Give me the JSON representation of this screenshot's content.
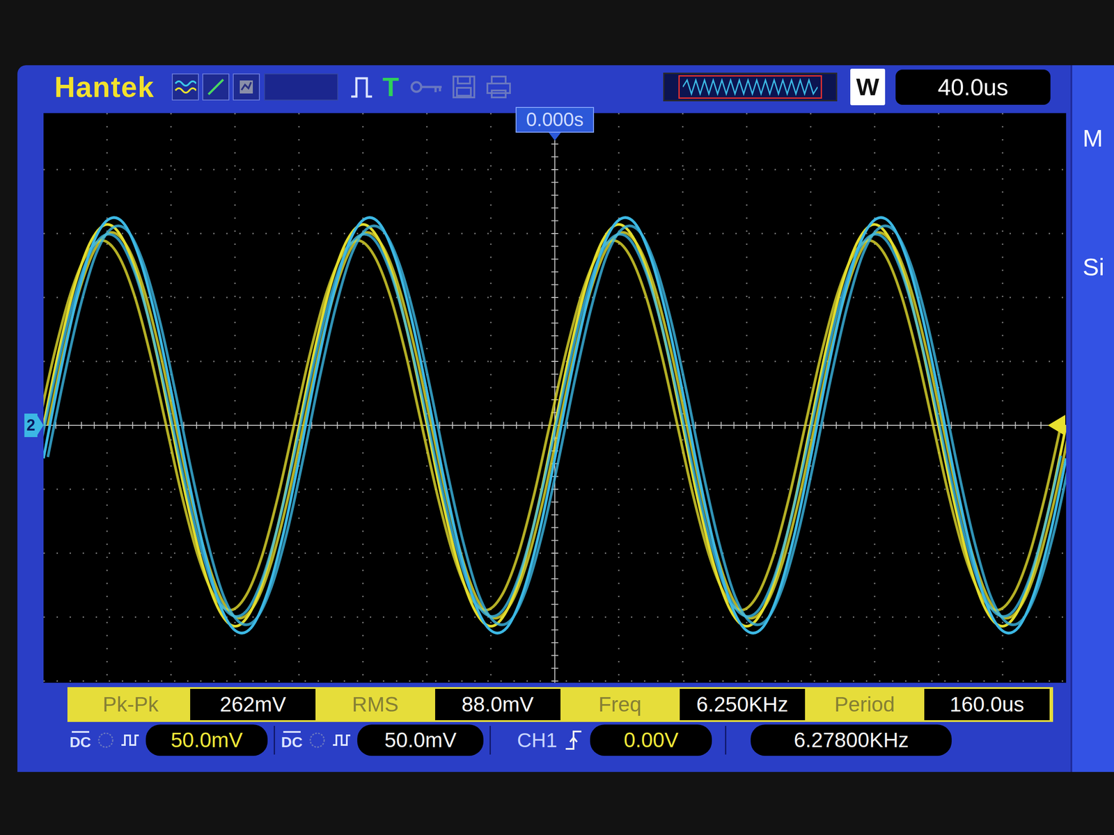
{
  "brand": "Hantek",
  "top_bar": {
    "run_indicator": "T",
    "mode": "W",
    "timebase": "40.0us"
  },
  "trigger_position": "0.000s",
  "channel_marker": "2",
  "chart": {
    "series": [
      {
        "color": "#e2dc2e",
        "values": [
          0,
          54,
          99,
          129,
          140,
          129,
          99,
          54,
          0,
          -54,
          -99,
          -129,
          -140,
          -129,
          -99,
          -54,
          0,
          54,
          99,
          129,
          140,
          129,
          99,
          54,
          0,
          -54,
          -99,
          -129,
          -140,
          -129,
          -99,
          -54,
          0,
          54,
          99,
          129,
          140,
          129,
          99,
          54,
          0,
          -54,
          -99,
          -129,
          -140,
          -129,
          -99,
          -54,
          0,
          54,
          99,
          129,
          140,
          129,
          99,
          54,
          0,
          -54,
          -99,
          -129,
          -140,
          -129,
          -99,
          -54,
          0
        ]
      },
      {
        "color": "#3cb8e4",
        "values": [
          -23,
          34,
          85,
          124,
          143,
          141,
          117,
          76,
          23,
          -34,
          -85,
          -124,
          -143,
          -141,
          -117,
          -76,
          -23,
          34,
          85,
          124,
          143,
          141,
          117,
          76,
          23,
          -34,
          -85,
          -124,
          -143,
          -141,
          -117,
          -76,
          -23,
          34,
          85,
          124,
          143,
          141,
          117,
          76,
          23,
          -34,
          -85,
          -124,
          -143,
          -141,
          -117,
          -76,
          -23,
          34,
          85,
          124,
          143,
          141,
          117,
          76,
          23,
          -34,
          -85,
          -124,
          -143,
          -141,
          -117,
          -76,
          -23
        ]
      }
    ]
  },
  "measurements": [
    {
      "label": "Pk-Pk",
      "value": "262mV"
    },
    {
      "label": "RMS",
      "value": "88.0mV"
    },
    {
      "label": "Freq",
      "value": "6.250KHz"
    },
    {
      "label": "Period",
      "value": "160.0us"
    }
  ],
  "status_bar": {
    "channels": [
      {
        "coupling": "DC",
        "scale": "50.0mV",
        "color": "#f0e838"
      },
      {
        "coupling": "DC",
        "scale": "50.0mV",
        "color": "#f2f2f2"
      }
    ],
    "trigger": {
      "source": "CH1",
      "level": "0.00V"
    },
    "counter": "6.27800KHz"
  },
  "side_panel": [
    "M",
    "Si"
  ]
}
